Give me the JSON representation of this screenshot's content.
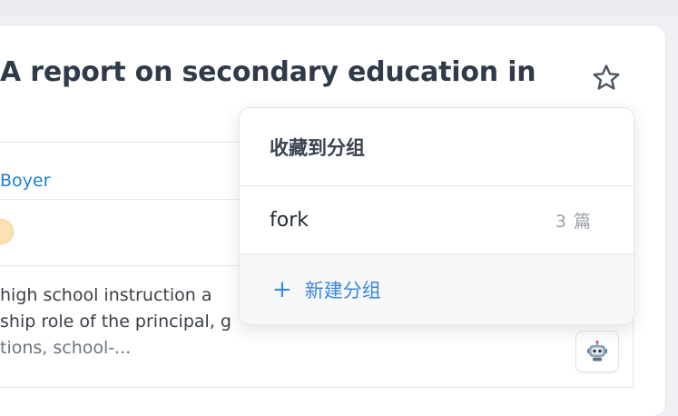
{
  "article": {
    "title": "A report on secondary education in",
    "author": "Boyer",
    "abstract_lines": [
      " high school instruction a",
      "ship role of the principal, g",
      "tions, school-..."
    ]
  },
  "favorite_popover": {
    "header": "收藏到分组",
    "groups": [
      {
        "name": "fork",
        "count": "3 篇"
      }
    ],
    "new_group_label": "新建分组"
  },
  "icons": {
    "star": "star-outline-icon",
    "ai_assistant": "robot-icon",
    "add": "plus-icon"
  },
  "colors": {
    "link": "#1f7fd1",
    "accent": "#3b86e0",
    "title": "#2f3b4b"
  }
}
